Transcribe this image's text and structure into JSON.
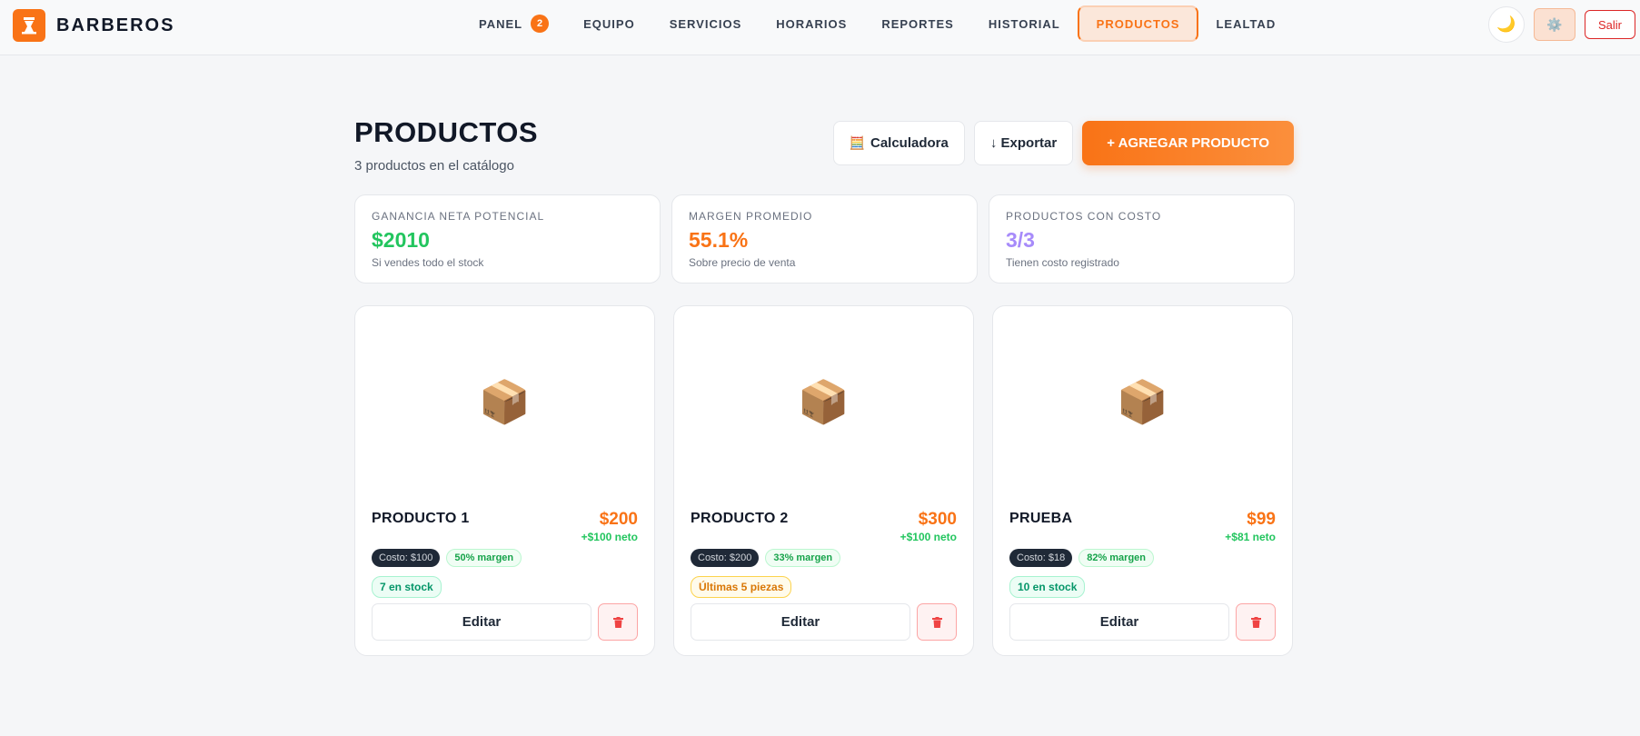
{
  "app": {
    "name": "BARBEROS"
  },
  "nav": {
    "items": [
      {
        "label": "PANEL",
        "badge": "2"
      },
      {
        "label": "EQUIPO"
      },
      {
        "label": "SERVICIOS"
      },
      {
        "label": "HORARIOS"
      },
      {
        "label": "REPORTES"
      },
      {
        "label": "HISTORIAL"
      },
      {
        "label": "PRODUCTOS",
        "active": true
      },
      {
        "label": "LEALTAD"
      }
    ],
    "logout_label": "Salir",
    "theme_icon": "🌙",
    "settings_icon": "⚙️"
  },
  "header": {
    "title": "PRODUCTOS",
    "subtitle": "3 productos en el catálogo",
    "calculator_label": "Calculadora",
    "calculator_icon": "🧮",
    "export_label": "↓ Exportar",
    "add_label": "+ AGREGAR PRODUCTO"
  },
  "stats": [
    {
      "label": "GANANCIA NETA POTENCIAL",
      "value": "$2010",
      "hint": "Si vendes todo el stock",
      "color": "#22c55e"
    },
    {
      "label": "MARGEN PROMEDIO",
      "value": "55.1%",
      "hint": "Sobre precio de venta",
      "color": "#f97316"
    },
    {
      "label": "PRODUCTOS CON COSTO",
      "value": "3/3",
      "hint": "Tienen costo registrado",
      "color": "#a78bfa"
    }
  ],
  "products": [
    {
      "name": "PRODUCTO 1",
      "price": "$200",
      "net": "+$100 neto",
      "cost": "Costo: $100",
      "margin": "50% margen",
      "stock": "7 en stock",
      "stock_level": "ok",
      "edit_label": "Editar",
      "icon": "📦"
    },
    {
      "name": "PRODUCTO 2",
      "price": "$300",
      "net": "+$100 neto",
      "cost": "Costo: $200",
      "margin": "33% margen",
      "stock": "Últimas 5 piezas",
      "stock_level": "low",
      "edit_label": "Editar",
      "icon": "📦"
    },
    {
      "name": "PRUEBA",
      "price": "$99",
      "net": "+$81 neto",
      "cost": "Costo: $18",
      "margin": "82% margen",
      "stock": "10 en stock",
      "stock_level": "ok",
      "edit_label": "Editar",
      "icon": "📦"
    }
  ]
}
